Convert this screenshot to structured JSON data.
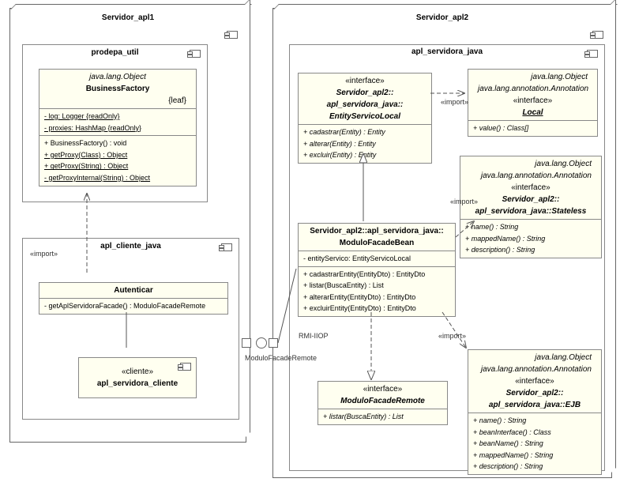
{
  "left_server": {
    "title": "Servidor_apl1"
  },
  "right_server": {
    "title": "Servidor_apl2"
  },
  "pkg_util": {
    "title": "prodepa_util"
  },
  "pkg_cliente": {
    "title": "apl_cliente_java"
  },
  "pkg_servidora": {
    "title": "apl_servidora_java"
  },
  "business_factory": {
    "parent": "java.lang.Object",
    "name": "BusinessFactory",
    "tag": "{leaf}",
    "attrs": [
      "- log: Logger {readOnly}",
      "- proxies: HashMap {readOnly}"
    ],
    "ops": [
      "+ BusinessFactory() : void",
      "+ getProxy(Class) : Object",
      "+ getProxy(String) : Object",
      "- getProxyInternal(String) : Object"
    ]
  },
  "autenticar": {
    "name": "Autenticar",
    "ops": [
      "- getAplServidoraFacade() : ModuloFacadeRemote"
    ]
  },
  "servidora_cliente": {
    "stereotype": "«cliente»",
    "name": "apl_servidora_cliente"
  },
  "entity_servico": {
    "stereotype": "«interface»",
    "line1": "Servidor_apl2::",
    "line2": "apl_servidora_java::",
    "name": "EntityServicoLocal",
    "ops": [
      "+ cadastrar(Entity) : Entity",
      "+ alterar(Entity) : Entity",
      "+ excluir(Entity) : Entity"
    ]
  },
  "local_iface": {
    "parent1": "java.lang.Object",
    "parent2": "java.lang.annotation.Annotation",
    "stereotype": "«interface»",
    "name": "Local",
    "ops": [
      "+ value() : Class[]"
    ]
  },
  "stateless_iface": {
    "parent1": "java.lang.Object",
    "parent2": "java.lang.annotation.Annotation",
    "stereotype": "«interface»",
    "line1": "Servidor_apl2::",
    "line2": "apl_servidora_java::Stateless",
    "ops": [
      "+ name() : String",
      "+ mappedName() : String",
      "+ description() : String"
    ]
  },
  "facade_bean": {
    "line1": "Servidor_apl2::apl_servidora_java::",
    "name": "ModuloFacadeBean",
    "attrs": [
      "- entityServico: EntityServicoLocal"
    ],
    "ops": [
      "+ cadastrarEntity(EntityDto) : EntityDto",
      "+ listar(BuscaEntity) : List",
      "+ alterarEntity(EntityDto) : EntityDto",
      "+ excluirEntity(EntityDto) : EntityDto"
    ]
  },
  "facade_remote": {
    "stereotype": "«interface»",
    "name": "ModuloFacadeRemote",
    "ops": [
      "+ listar(BuscaEntity) : List"
    ]
  },
  "ejb_iface": {
    "parent1": "java.lang.Object",
    "parent2": "java.lang.annotation.Annotation",
    "stereotype": "«interface»",
    "line1": "Servidor_apl2::",
    "line2": "apl_servidora_java::EJB",
    "ops": [
      "+ name() : String",
      "+ beanInterface() : Class",
      "+ beanName() : String",
      "+ mappedName() : String",
      "+ description() : String"
    ]
  },
  "labels": {
    "import": "«import»",
    "rmi": "RMI-IIOP",
    "facade_remote_label": "ModuloFacadeRemote"
  }
}
